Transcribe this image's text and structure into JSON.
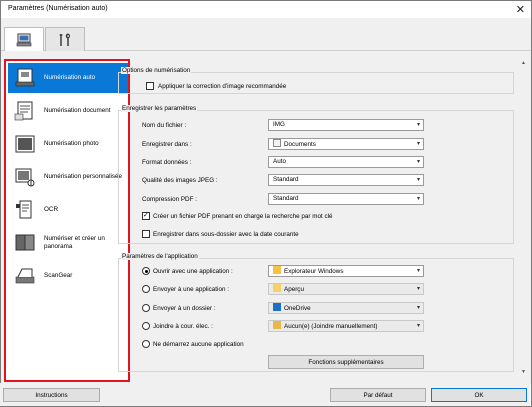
{
  "window": {
    "title": "Paramètres (Numérisation auto)"
  },
  "tabs": [
    {
      "icon": "computer-scanner-icon"
    },
    {
      "icon": "tools-icon"
    }
  ],
  "sidebar": {
    "items": [
      {
        "label": "Numérisation auto",
        "icon": "auto-scan-icon",
        "selected": true
      },
      {
        "label": "Numérisation document",
        "icon": "document-scan-icon"
      },
      {
        "label": "Numérisation photo",
        "icon": "photo-scan-icon"
      },
      {
        "label": "Numérisation personnalisée",
        "icon": "custom-scan-icon"
      },
      {
        "label": "OCR",
        "icon": "ocr-icon"
      },
      {
        "label_line1": "Numériser et créer un",
        "label_line2": "panorama",
        "icon": "panorama-icon"
      },
      {
        "label": "ScanGear",
        "icon": "scangear-icon"
      }
    ]
  },
  "options": {
    "group_title": "Options de numérisation",
    "apply_correction": "Appliquer la correction d'image recommandée"
  },
  "save": {
    "group_title": "Enregistrer les paramètres",
    "filename_label": "Nom du fichier :",
    "filename_value": "IMG",
    "save_in_label": "Enregistrer dans :",
    "save_in_value": "Documents",
    "format_label": "Format données :",
    "format_value": "Auto",
    "jpeg_label": "Qualité des images JPEG :",
    "jpeg_value": "Standard",
    "pdf_label": "Compression PDF :",
    "pdf_value": "Standard",
    "searchable_pdf": "Créer un fichier PDF prenant en charge la recherche par mot clé",
    "subfolder": "Enregistrer dans sous-dossier avec la date courante"
  },
  "app": {
    "group_title": "Paramètres de l'application",
    "open_label": "Ouvrir avec une application :",
    "open_value": "Explorateur Windows",
    "send_app_label": "Envoyer à une application :",
    "send_app_value": "Aperçu",
    "send_folder_label": "Envoyer à un dossier :",
    "send_folder_value": "OneDrive",
    "email_label": "Joindre à cour. élec. :",
    "email_value": "Aucun(e) (Joindre manuellement)",
    "none_label": "Ne démarrez aucune application",
    "more_button": "Fonctions supplémentaires"
  },
  "footer": {
    "instructions": "Instructions",
    "defaults": "Par défaut",
    "ok": "OK"
  },
  "colors": {
    "accent": "#0a78d7",
    "highlight_border": "#e0141e"
  }
}
